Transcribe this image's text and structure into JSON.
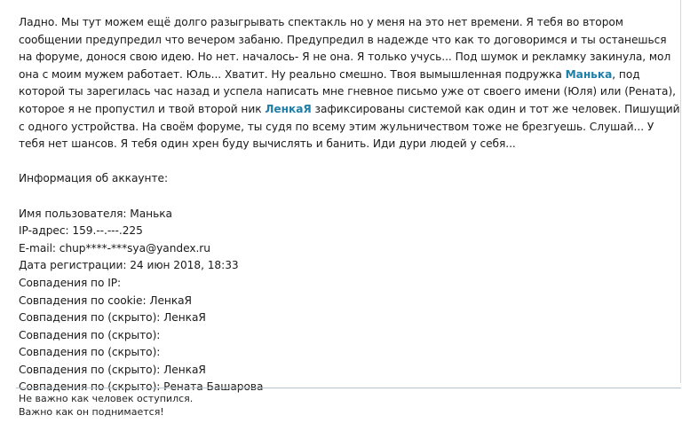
{
  "post": {
    "paragraph": {
      "segments": [
        {
          "text": "Ладно. Мы тут можем ещё долго разыгрывать спектакль но у меня на это нет времени. Я тебя во втором сообщении предупредил что вечером забаню. Предупредил в надежде что как то договоримся и ты останешься на форуме, донося свою идею. Но нет. началось- Я не она. Я только учусь... Под шумок и рекламку закинула, мол она с моим мужем работает. Юль... Хватит. Ну реально смешно. Твоя вымышленная подружка "
        },
        {
          "text": "Манька",
          "link": true
        },
        {
          "text": ", под которой ты зарегилась час назад и успела написать мне гневное письмо уже от своего имени (Юля) или (Рената), которое я не пропустил и твой второй ник "
        },
        {
          "text": "ЛенкаЯ",
          "link": true
        },
        {
          "text": " зафиксированы системой как один и тот же человек. Пишущий с одного устройства. На своём форуме, ты судя по всему этим жульничеством тоже не брезгуешь. Слушай... У тебя нет шансов. Я тебя один хрен буду вычислять и банить. Иди дури людей у себя..."
        }
      ]
    },
    "account_info_heading": "Информация об аккаунте:",
    "account_info_lines": [
      "Имя пользователя: Манька",
      "IP-адрес: 159.--.---.225",
      "E-mail: chup****-***sya@yandex.ru",
      "Дата регистрации: 24 июн 2018, 18:33",
      "Совпадения по IP:",
      "Совпадения по cookie: ЛенкаЯ",
      "Совпадения по (скрыто): ЛенкаЯ",
      "Совпадения по (скрыто):",
      "Совпадения по (скрыто):",
      "Совпадения по (скрыто): ЛенкаЯ",
      "Совпадения по (скрыто): Рената Башарова"
    ]
  },
  "signature": {
    "line1": "Не важно как человек оступился.",
    "line2": "Важно как он поднимается!"
  },
  "colors": {
    "link": "#1e7fa8",
    "text": "#1a1a1a",
    "divider": "#b9c3cc"
  }
}
